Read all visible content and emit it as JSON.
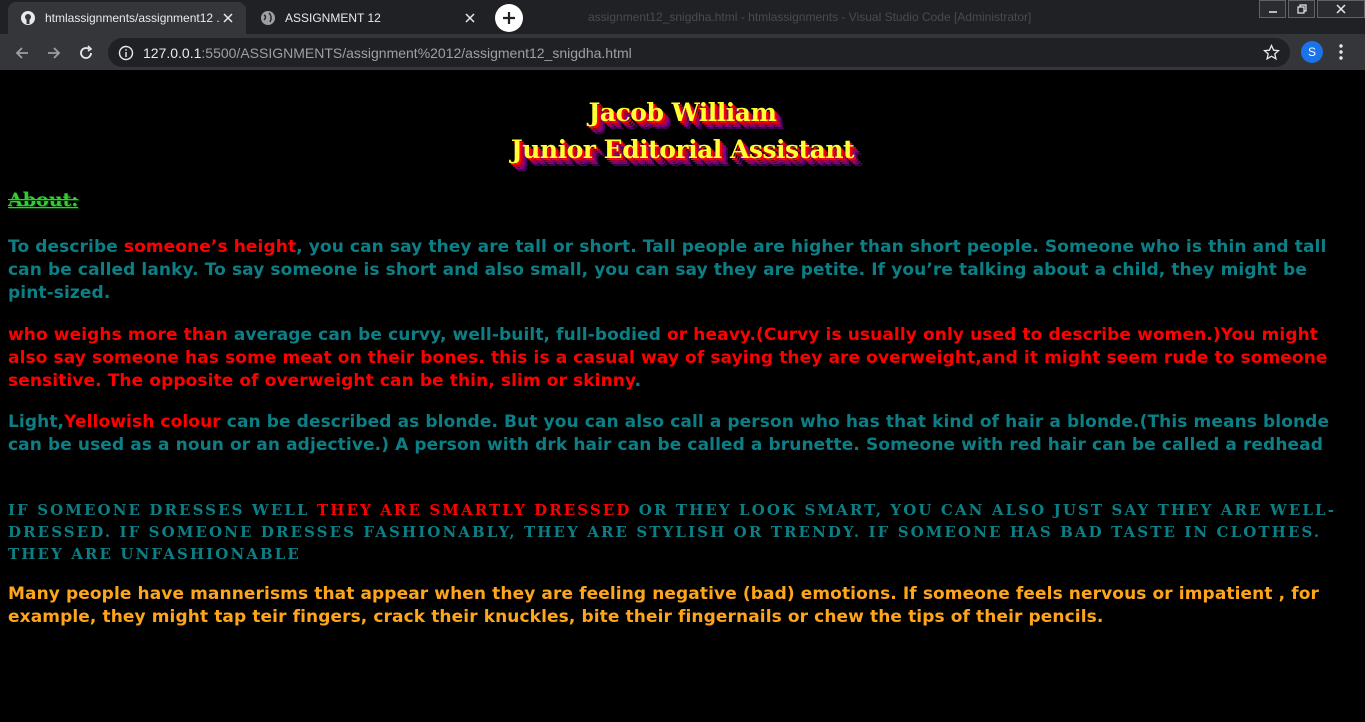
{
  "browser": {
    "tabs": [
      {
        "title": "htmlassignments/assignment12 ...",
        "active": true,
        "icon": "github-icon"
      },
      {
        "title": "ASSIGNMENT 12",
        "active": false,
        "icon": "globe-icon"
      }
    ],
    "background_window_title": "assignment12_snigdha.html - htmlassignments - Visual Studio Code [Administrator]",
    "url_host": "127.0.0.1",
    "url_rest": ":5500/ASSIGNMENTS/assignment%2012/assigment12_snigdha.html",
    "profile_initial": "S"
  },
  "page": {
    "heading_line1": "Jacob William",
    "heading_line2": "Junior Editorial Assistant",
    "about_label": "About:",
    "p1": {
      "a": "To describe ",
      "b": "someone’s height",
      "c": ", you can say they are tall or short. Tall people are higher than short people. Someone who is thin and tall can be called lanky. To say someone is short and also small, you can say they are petite. If you’re talking about a child, they might be pint-sized."
    },
    "p2": {
      "a": "who weighs more than ",
      "b": "average can be curvy, well-built, full-bodied",
      "c": " or heavy.(Curvy is usually only used to describe women.)You might also say someone has some meat on their bones. this is a casual way of saying they are overweight,and it might seem rude to someone sensitive. The opposite of overweight can be thin, slim or skinny",
      "d": "."
    },
    "p3": {
      "a": "Light,",
      "b": "Yellowish colour",
      "c": " can be described as blonde. But you can also call a person who has that kind of hair a blonde.(This means blonde can be used as a noun or an adjective.) A person with drk hair can be called a brunette. Someone with red hair can be called a redhead"
    },
    "p4": {
      "a": "If someone dresses well ",
      "b": "they are smartly dressed",
      "c": " or they look smart, you can also just say they are well-dressed. If someone dresses fashionably, they are stylish or trendy. If someone has bad taste in clothes. they are unfashionable"
    },
    "p5": "Many people have mannerisms that appear when they are feeling negative (bad) emotions. If someone feels nervous or impatient , for example, they might tap teir fingers, crack their knuckles, bite their fingernails or chew the tips of their pencils."
  },
  "colors": {
    "heading": "#ffff33",
    "about": "#33cc33",
    "teal": "#0c7f86",
    "red": "#ff0000",
    "orange": "#ffa51c"
  }
}
